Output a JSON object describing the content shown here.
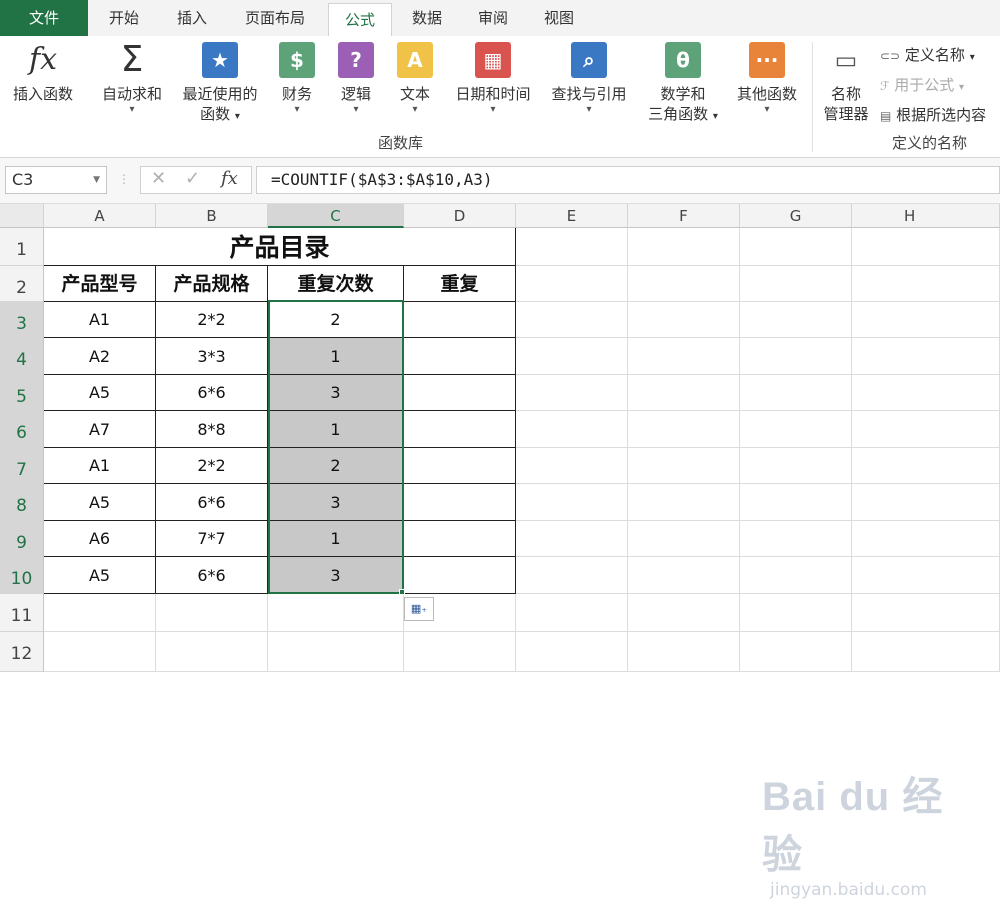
{
  "tabs": [
    {
      "label": "文件"
    },
    {
      "label": "开始"
    },
    {
      "label": "插入"
    },
    {
      "label": "页面布局"
    },
    {
      "label": "公式"
    },
    {
      "label": "数据"
    },
    {
      "label": "审阅"
    },
    {
      "label": "视图"
    }
  ],
  "ribbon": {
    "insert_function": "插入函数",
    "autosum": "自动求和",
    "recent": [
      "最近使用的",
      "函数"
    ],
    "finance": "财务",
    "logic": "逻辑",
    "text": "文本",
    "datetime": "日期和时间",
    "lookup": "查找与引用",
    "math": [
      "数学和",
      "三角函数"
    ],
    "other": "其他函数",
    "group_label": "函数库",
    "name_manager": [
      "名称",
      "管理器"
    ],
    "define_name": "定义名称",
    "use_in_formula": "用于公式",
    "create_from_selection": "根据所选内容",
    "names_group_label": "定义的名称"
  },
  "formula_bar": {
    "name_box": "C3",
    "formula": "=COUNTIF($A$3:$A$10,A3)"
  },
  "columns": [
    "A",
    "B",
    "C",
    "D",
    "E",
    "F",
    "G",
    "H"
  ],
  "rows": [
    "1",
    "2",
    "3",
    "4",
    "5",
    "6",
    "7",
    "8",
    "9",
    "10",
    "11",
    "12"
  ],
  "sheet": {
    "title": "产品目录",
    "headers": [
      "产品型号",
      "产品规格",
      "重复次数",
      "重复"
    ],
    "data": [
      [
        "A1",
        "2*2",
        "2",
        ""
      ],
      [
        "A2",
        "3*3",
        "1",
        ""
      ],
      [
        "A5",
        "6*6",
        "3",
        ""
      ],
      [
        "A7",
        "8*8",
        "1",
        ""
      ],
      [
        "A1",
        "2*2",
        "2",
        ""
      ],
      [
        "A5",
        "6*6",
        "3",
        ""
      ],
      [
        "A6",
        "7*7",
        "1",
        ""
      ],
      [
        "A5",
        "6*6",
        "3",
        ""
      ]
    ]
  },
  "watermark": {
    "big": "Bai du 经验",
    "small": "jingyan.baidu.com"
  },
  "colors": {
    "accent": "#217346",
    "selection": "#c8c8c8"
  }
}
